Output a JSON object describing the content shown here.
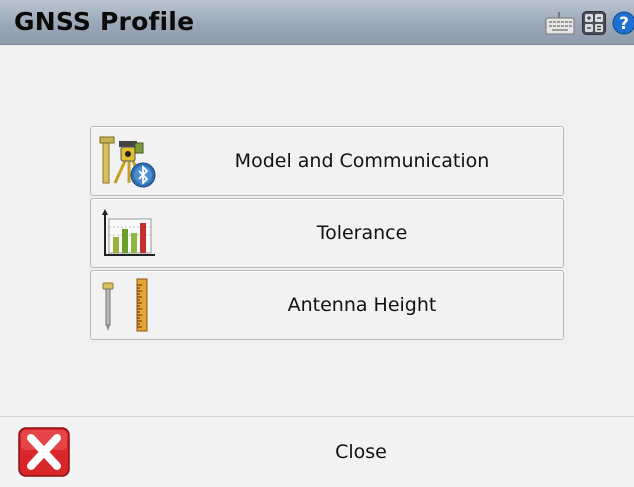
{
  "window": {
    "title": "GNSS Profile"
  },
  "toolbar": {
    "icons": [
      "keyboard-icon",
      "calculator-icon",
      "help-icon"
    ]
  },
  "menu": {
    "items": [
      {
        "label": "Model and Communication",
        "icon": "receiver-bluetooth-icon"
      },
      {
        "label": "Tolerance",
        "icon": "tolerance-bars-icon"
      },
      {
        "label": "Antenna Height",
        "icon": "antenna-height-icon"
      }
    ]
  },
  "footer": {
    "close_label": "Close",
    "close_icon": "close-x-icon"
  },
  "colors": {
    "titlebar": "#9aa7b6",
    "close_red": "#d8262b",
    "help_blue": "#1e6fd0"
  }
}
